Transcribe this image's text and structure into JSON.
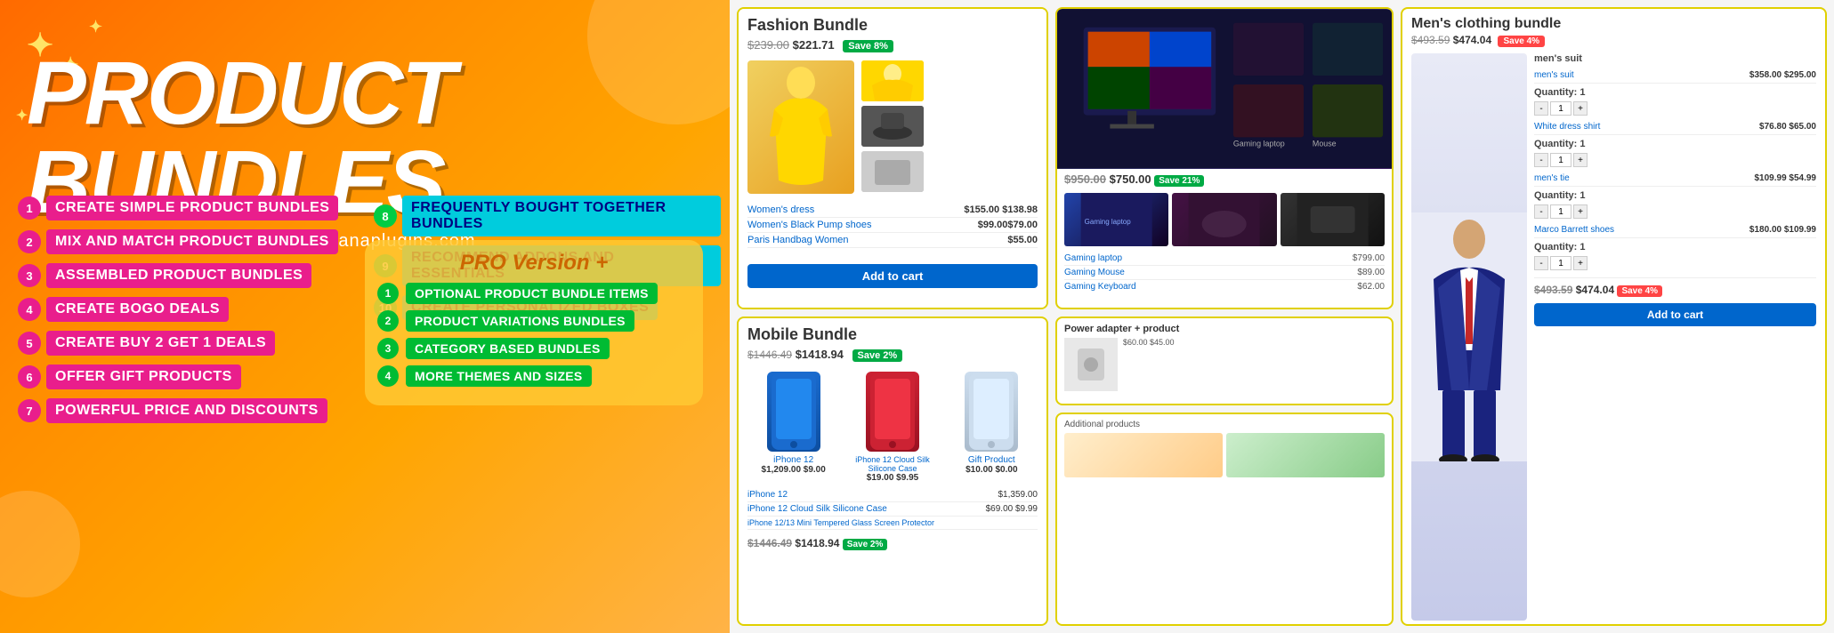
{
  "brand": {
    "website": "www.asanaplugins.com"
  },
  "hero": {
    "title": "PRODUCT BUNDLES"
  },
  "features_left": [
    {
      "num": "1",
      "label": "CREATE SIMPLE PRODUCT BUNDLES"
    },
    {
      "num": "2",
      "label": "MIX AND MATCH PRODUCT BUNDLES"
    },
    {
      "num": "3",
      "label": "ASSEMBLED PRODUCT BUNDLES"
    },
    {
      "num": "4",
      "label": "CREATE BOGO DEALS"
    },
    {
      "num": "5",
      "label": "CREATE BUY 2 GET 1 DEALS"
    },
    {
      "num": "6",
      "label": "OFFER GIFT PRODUCTS"
    },
    {
      "num": "7",
      "label": "POWERFUL PRICE AND DISCOUNTS"
    }
  ],
  "features_right": [
    {
      "num": "8",
      "label": "FREQUENTLY BOUGHT TOGETHER BUNDLES"
    },
    {
      "num": "9",
      "label": "RECOMMEND ADDONS AND ESSENTIALS"
    },
    {
      "num": "10",
      "label": "CREATE PERSONALIZED BOXES"
    }
  ],
  "pro": {
    "title": "PRO Version +",
    "items": [
      {
        "num": "1",
        "label": "OPTIONAL PRODUCT BUNDLE ITEMS"
      },
      {
        "num": "2",
        "label": "PRODUCT VARIATIONS BUNDLES"
      },
      {
        "num": "3",
        "label": "CATEGORY BASED BUNDLES"
      },
      {
        "num": "4",
        "label": "MORE THEMES AND SIZES"
      }
    ]
  },
  "screenshots": {
    "fashion": {
      "title": "Fashion Bundle",
      "old_price": "$239.00",
      "new_price": "$221.71",
      "badge": "Save 8%",
      "products": [
        {
          "name": "Women's dress",
          "price": "$155.00 $138.98"
        },
        {
          "name": "Women's Black Pump shoes",
          "price": "$99.00$79.00"
        },
        {
          "name": "Paris Handbag Women",
          "price": "$55.00"
        }
      ]
    },
    "mobile": {
      "title": "Mobile Bundle",
      "old_price": "$1446.49",
      "new_price": "$1418.94",
      "badge": "Save 2%",
      "products": [
        {
          "name": "iPhone 12",
          "price": "$1,209.00 $9.00"
        },
        {
          "name": "iPhone 12 Cloud Silk\nSilicone Case",
          "price": "$19.00 $9.95"
        },
        {
          "name": "Gift Product",
          "price": "$10.00 $0.00"
        }
      ],
      "totals": [
        {
          "label": "iPhone 12",
          "price": "$1,359.00"
        },
        {
          "label": "iPhone 12 Cloud Silk Silicone Case",
          "price": "$69.00 $9.99"
        },
        {
          "label": "iPhone 12 / 13 Mini Tempered Glass\nScreen Protector",
          "price": ""
        }
      ],
      "footer_price": "$1446.49 $1418.94"
    },
    "mens_suit": {
      "title": "Men's clothing bundle",
      "old_price": "$493.59",
      "new_price": "$474.04",
      "badge": "Save 4%",
      "products": [
        {
          "name": "men's suit",
          "price": "$358.00 $295.00"
        },
        {
          "name": "White dress shirt",
          "price": "$76.80 $65.00"
        },
        {
          "name": "men's tie",
          "price": "$109.99 $54.99"
        },
        {
          "name": "Marco Barrett shoes",
          "price": "$180.00 $109.99"
        }
      ]
    }
  },
  "colors": {
    "pink": "#e91e8c",
    "orange": "#ff8c00",
    "green": "#00bb33",
    "cyan": "#00ccdd",
    "gold": "#ffa500"
  }
}
